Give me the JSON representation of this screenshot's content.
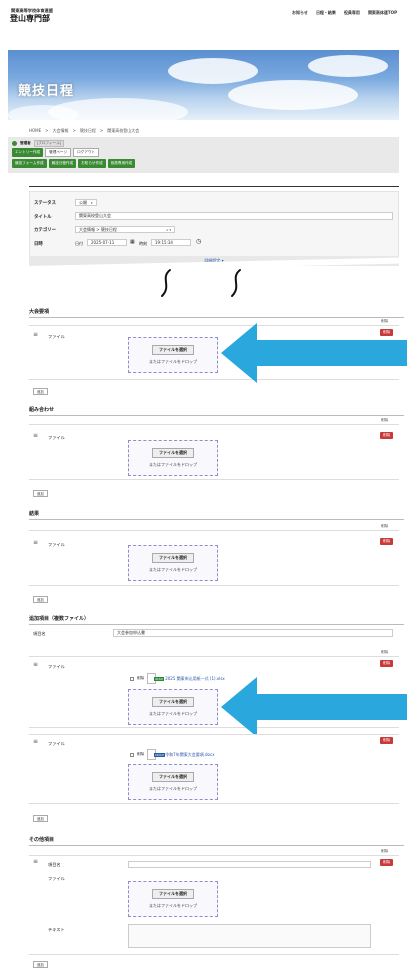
{
  "header": {
    "org": "関東高等学校体育連盟",
    "title": "登山専門部",
    "nav": [
      "お知らせ",
      "日程・結果",
      "役員専用",
      "関東高体連TOP"
    ]
  },
  "hero": {
    "title": "競技日程"
  },
  "breadcrumb": [
    "HOME",
    ">",
    "大会情報",
    ">",
    "競技日程",
    ">",
    "関東高校登山大会"
  ],
  "admin": {
    "role": "管理者",
    "tag": "[プロフィール]",
    "row2": [
      {
        "label": "エントリー作成",
        "style": "green"
      },
      {
        "label": "管理ページ",
        "style": "white"
      },
      {
        "label": "ログアウト",
        "style": "white"
      }
    ],
    "row3": [
      "競技フォーム作成",
      "競技日程作成",
      "お知らせ作成",
      "役員専用作成"
    ]
  },
  "form": {
    "status_label": "ステータス",
    "status_value": "公開",
    "title_label": "タイトル",
    "title_value": "関東高校登山大会",
    "category_label": "カテゴリー",
    "category_value": "大会情報 > 競技日程",
    "date_label": "日時",
    "date_sub": "日付",
    "date_value": "2025-07-11",
    "time_sub": "時刻",
    "time_value": "19:15:34",
    "detail_toggle": "詳細設定 ▾"
  },
  "sections": {
    "taikai": {
      "title": "大会要項",
      "sort": "削除",
      "file_label": "ファイル",
      "delete": "削除",
      "add": "追加"
    },
    "kumiawase": {
      "title": "組み合わせ",
      "sort": "削除",
      "file_label": "ファイル",
      "delete": "削除",
      "add": "追加"
    },
    "kekka": {
      "title": "結果",
      "sort": "削除",
      "file_label": "ファイル",
      "delete": "削除",
      "add": "追加"
    },
    "tsuika": {
      "title": "追加項目（複数ファイル）",
      "item_name_label": "項目名",
      "item_name_value": "大会参加申込書",
      "sort": "削除",
      "add": "追加",
      "rows": [
        {
          "file_label": "ファイル",
          "delete": "削除",
          "chk_label": "削除",
          "file_type": "XLSX",
          "file_name": "2025 関東申込用紙一式 (1).xlsx"
        },
        {
          "file_label": "ファイル",
          "delete": "削除",
          "chk_label": "削除",
          "file_type": "DOCX",
          "file_name": "令和7年関東大会要項.docx"
        }
      ]
    },
    "sonota": {
      "title": "その他項目",
      "sort": "削除",
      "item_name_label": "項目名",
      "file_label": "ファイル",
      "text_label": "テキスト",
      "delete": "削除",
      "add": "追加"
    }
  },
  "dropzone": {
    "button": "ファイルを選択",
    "text": "またはファイルをドロップ"
  },
  "colors": {
    "arrow": "#2aa7dc",
    "green": "#3a8a34",
    "delete": "#c93a3a",
    "link": "#2c55a8"
  }
}
